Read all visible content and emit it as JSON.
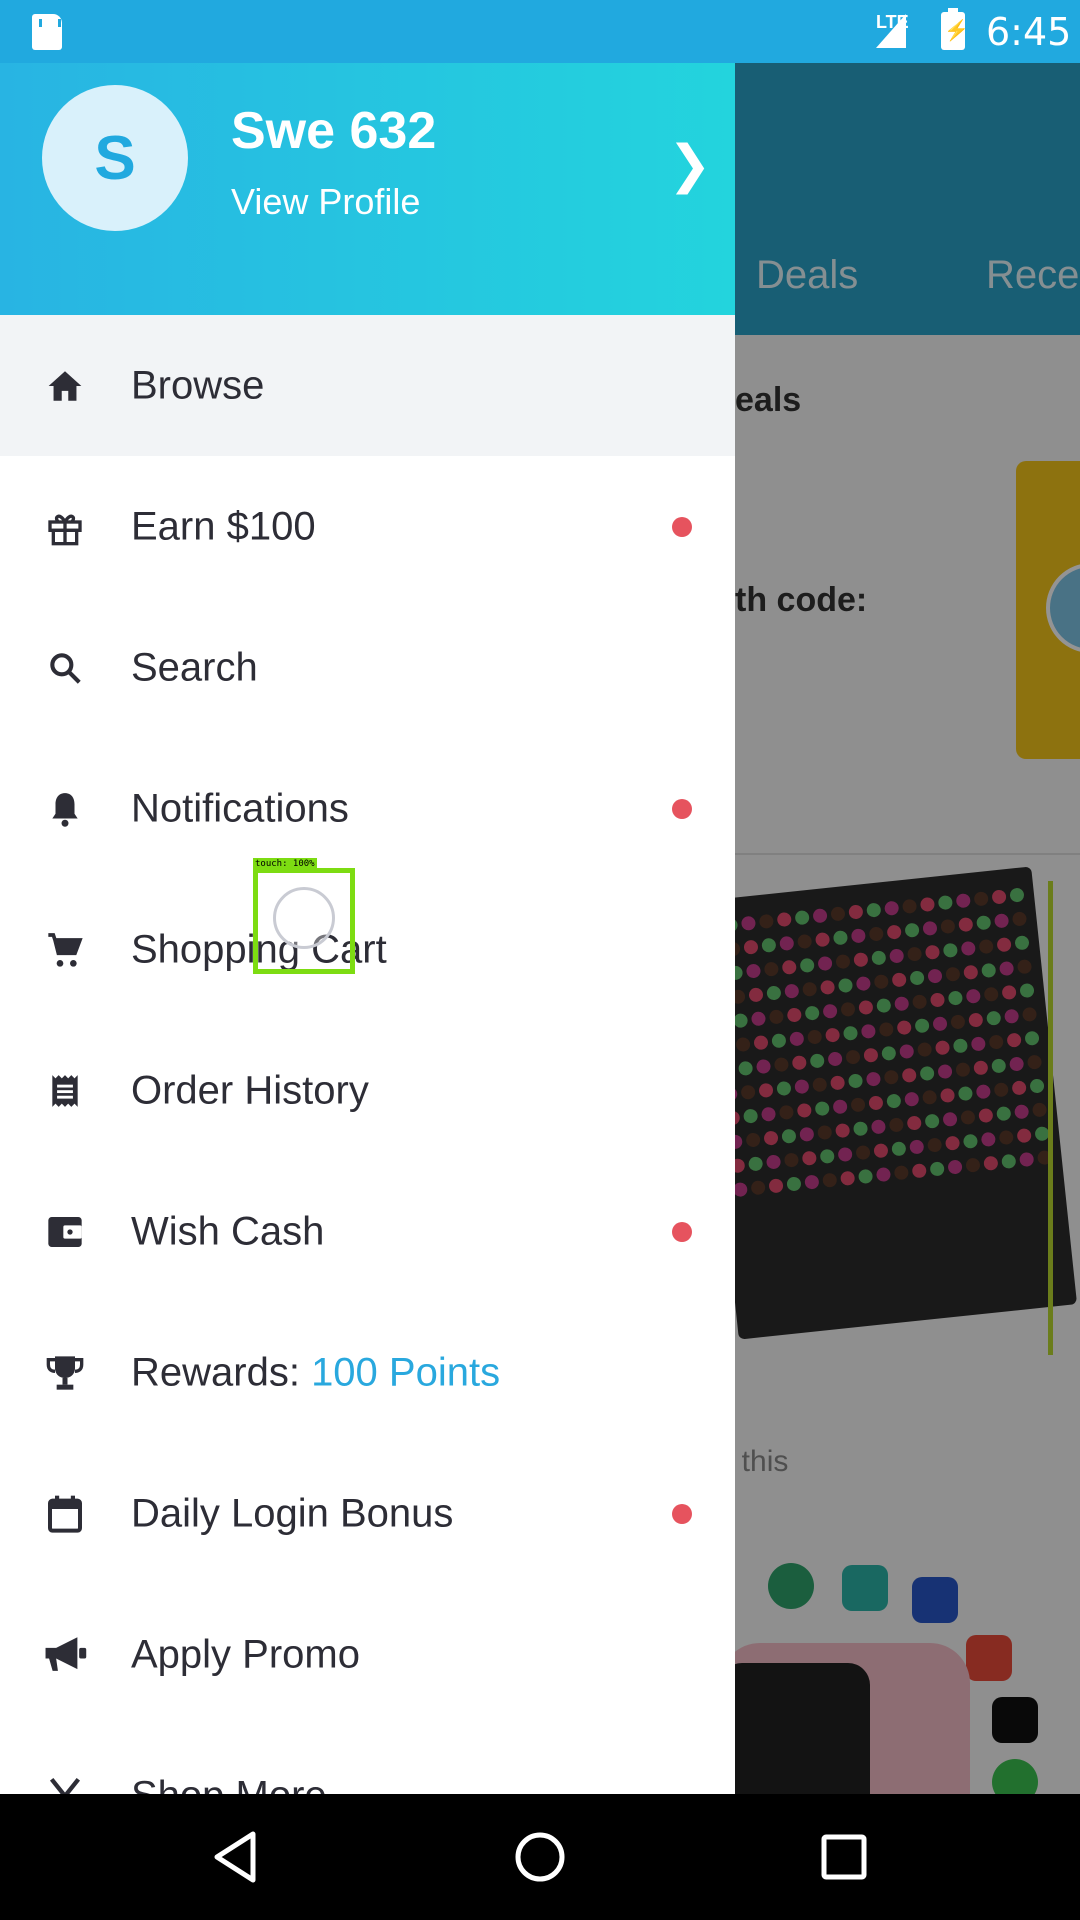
{
  "status_bar": {
    "network": "LTE",
    "time": "6:45"
  },
  "background": {
    "tabs": [
      "Deals",
      "Rece"
    ],
    "heading": "eals",
    "promo_text": "th code:",
    "caption": ": this"
  },
  "profile": {
    "initial": "S",
    "name": "Swe 632",
    "link": "View Profile"
  },
  "menu": [
    {
      "label": "Browse",
      "icon": "home-icon",
      "dot": false,
      "active": true
    },
    {
      "label": "Earn $100",
      "icon": "gift-icon",
      "dot": true
    },
    {
      "label": "Search",
      "icon": "search-icon",
      "dot": false
    },
    {
      "label": "Notifications",
      "icon": "bell-icon",
      "dot": true
    },
    {
      "label": "Shopping Cart",
      "icon": "cart-icon",
      "dot": false
    },
    {
      "label": "Order History",
      "icon": "receipt-icon",
      "dot": false
    },
    {
      "label": "Wish Cash",
      "icon": "wallet-icon",
      "dot": true
    },
    {
      "label": "Rewards: ",
      "accent": "100 Points",
      "icon": "trophy-icon",
      "dot": false
    },
    {
      "label": "Daily Login Bonus",
      "icon": "calendar-icon",
      "dot": true
    },
    {
      "label": "Apply Promo",
      "icon": "megaphone-icon",
      "dot": false
    },
    {
      "label": "Shop More",
      "icon": "yen-icon",
      "dot": false
    }
  ],
  "touch": {
    "label": "touch: 100%"
  },
  "colors": {
    "accent": "#21a9df",
    "dot": "#e6535e",
    "touch": "#7ddc12"
  }
}
